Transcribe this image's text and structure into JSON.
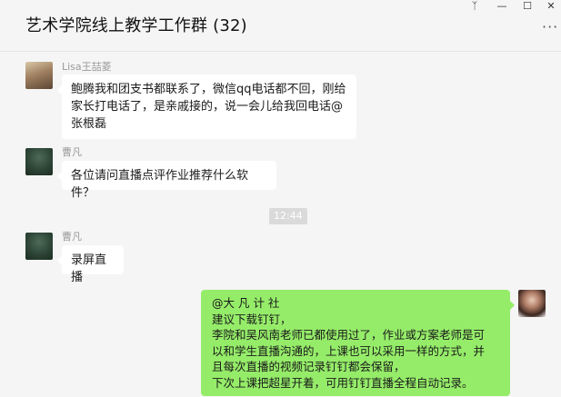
{
  "window": {
    "title": "艺术学院线上教学工作群 (32)",
    "controls": {
      "pin": "ᛉ",
      "minimize": "—",
      "maximize": "☐",
      "close": "✕"
    },
    "more_label": "···"
  },
  "messages": [
    {
      "sender": "Lisa王喆菱",
      "text": "鲍腾我和团支书都联系了，微信qq电话都不回，刚给家长打电话了，是亲戚接的，说一会儿给我回电话@张根磊"
    },
    {
      "sender": "曹凡",
      "text": "各位请问直播点评作业推荐什么软件？"
    },
    {
      "timestamp": "12:44"
    },
    {
      "sender": "曹凡",
      "text": "录屏直播"
    },
    {
      "sender": "",
      "text_lines": [
        "@大 凡 计 社",
        "建议下载钉钉，",
        "李院和吴风南老师已都使用过了，作业或方案老师是可",
        "以和学生直播沟通的，上课也可以采用一样的方式，并",
        "且每次直播的视频记录钉钉都会保留，",
        "下次上课把超星开着，可用钉钉直播全程自动记录。"
      ]
    }
  ],
  "icons": {
    "avatar_lisa": "avatar-lisa",
    "avatar_cao": "avatar-cao-fan",
    "avatar_me": "avatar-self"
  }
}
